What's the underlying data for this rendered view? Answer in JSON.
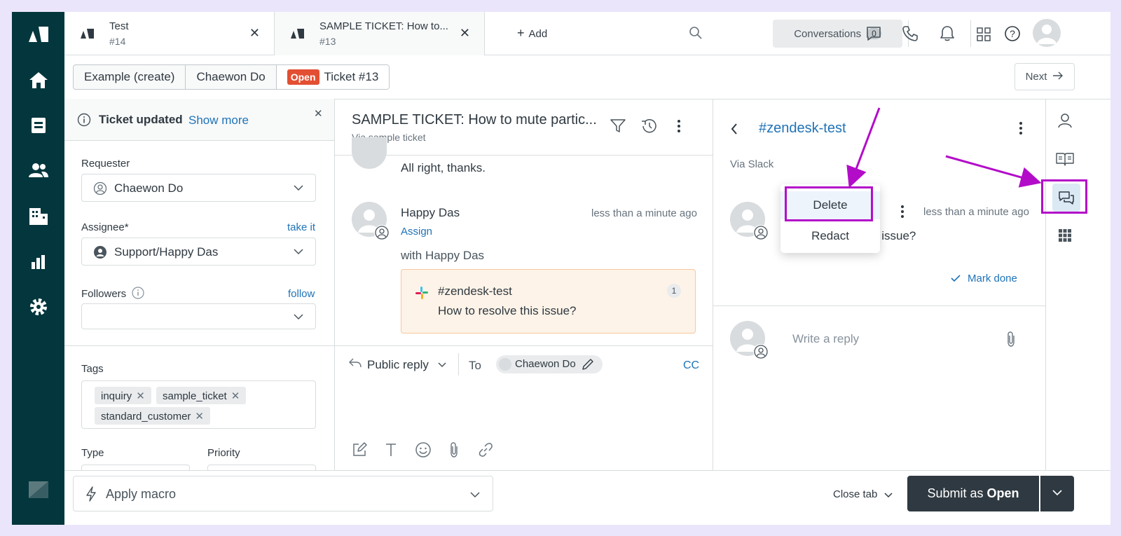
{
  "tabs": [
    {
      "title": "Test",
      "subtitle": "#14"
    },
    {
      "title": "SAMPLE TICKET: How to...",
      "subtitle": "#13"
    }
  ],
  "add_tab_label": "Add",
  "conversations": {
    "label": "Conversations",
    "count": "0"
  },
  "breadcrumb": {
    "item1": "Example (create)",
    "item2": "Chaewon Do",
    "status": "Open",
    "ticket": "Ticket #13"
  },
  "next_label": "Next",
  "notice": {
    "text": "Ticket updated",
    "link": "Show more"
  },
  "fields": {
    "requester_label": "Requester",
    "requester_value": "Chaewon Do",
    "assignee_label": "Assignee*",
    "assignee_link": "take it",
    "assignee_value": "Support/Happy Das",
    "followers_label": "Followers",
    "followers_link": "follow",
    "tags_label": "Tags",
    "tags": [
      "inquiry",
      "sample_ticket",
      "standard_customer"
    ],
    "type_label": "Type",
    "priority_label": "Priority"
  },
  "conversation": {
    "title": "SAMPLE TICKET: How to mute partic...",
    "via": "Via sample ticket",
    "prev_message": "All right, thanks.",
    "author": "Happy Das",
    "time": "less than a minute ago",
    "assign_link": "Assign",
    "with_text": "with Happy Das",
    "slack_channel": "#zendesk-test",
    "slack_count": "1",
    "slack_message": "How to resolve this issue?"
  },
  "reply": {
    "mode": "Public reply",
    "to_label": "To",
    "recipient": "Chaewon Do",
    "cc": "CC"
  },
  "side_conversation": {
    "channel": "#zendesk-test",
    "via": "Via Slack",
    "time": "less than a minute ago",
    "message_fragment": "s issue?",
    "mark_done": "Mark done",
    "reply_placeholder": "Write a reply"
  },
  "context_menu": {
    "delete": "Delete",
    "redact": "Redact"
  },
  "bottom": {
    "macro": "Apply macro",
    "close_tab": "Close tab",
    "submit_prefix": "Submit as",
    "submit_status": "Open"
  },
  "colors": {
    "rail": "#03363d",
    "accent": "#1f73b7",
    "open_badge": "#e34f32",
    "annotation": "#b30cc9",
    "submit": "#2f3941"
  }
}
